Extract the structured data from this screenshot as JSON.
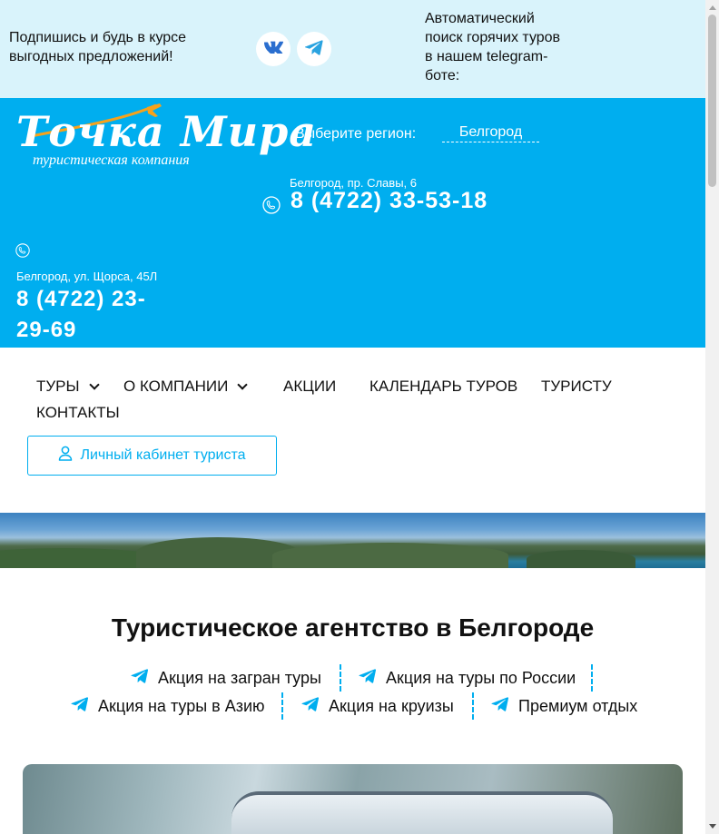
{
  "topbar": {
    "subscribe_text": "Подпишись и будь в курсе выгодных предложений!",
    "bot_text": "Автоматический поиск горячих туров в нашем telegram-боте:",
    "social": [
      {
        "name": "vk-icon"
      },
      {
        "name": "telegram-icon"
      }
    ]
  },
  "header": {
    "logo_title": "Точка Мира",
    "logo_subtitle": "туристическая компания",
    "region_label": "Выберите регион:",
    "region_value": "Белгород",
    "office1": {
      "address": "Белгород, пр. Славы, 6",
      "phone": "8 (4722) 33-53-18"
    },
    "office2": {
      "address": "Белгород, ул. Щорса, 45Л",
      "phone": "8 (4722) 23-29-69"
    }
  },
  "nav": {
    "items": [
      {
        "label": "ТУРЫ",
        "dropdown": true
      },
      {
        "label": "О КОМПАНИИ",
        "dropdown": true
      },
      {
        "label": "АКЦИИ",
        "dropdown": false
      },
      {
        "label": "КАЛЕНДАРЬ ТУРОВ",
        "dropdown": false
      },
      {
        "label": "ТУРИСТУ",
        "dropdown": false
      },
      {
        "label": "КОНТАКТЫ",
        "dropdown": false
      }
    ],
    "cabinet_label": "Личный кабинет туриста"
  },
  "main": {
    "title": "Туристическое агентство в Белгороде",
    "promos": [
      {
        "label": "Акция на загран туры"
      },
      {
        "label": "Акция на туры по России"
      },
      {
        "label": "Акция на туры в Азию"
      },
      {
        "label": "Акция на круизы"
      },
      {
        "label": "Премиум отдых"
      }
    ]
  },
  "colors": {
    "accent": "#00aeef",
    "topbar_bg": "#d9f3fb",
    "logo_plane": "#f7a21b"
  }
}
